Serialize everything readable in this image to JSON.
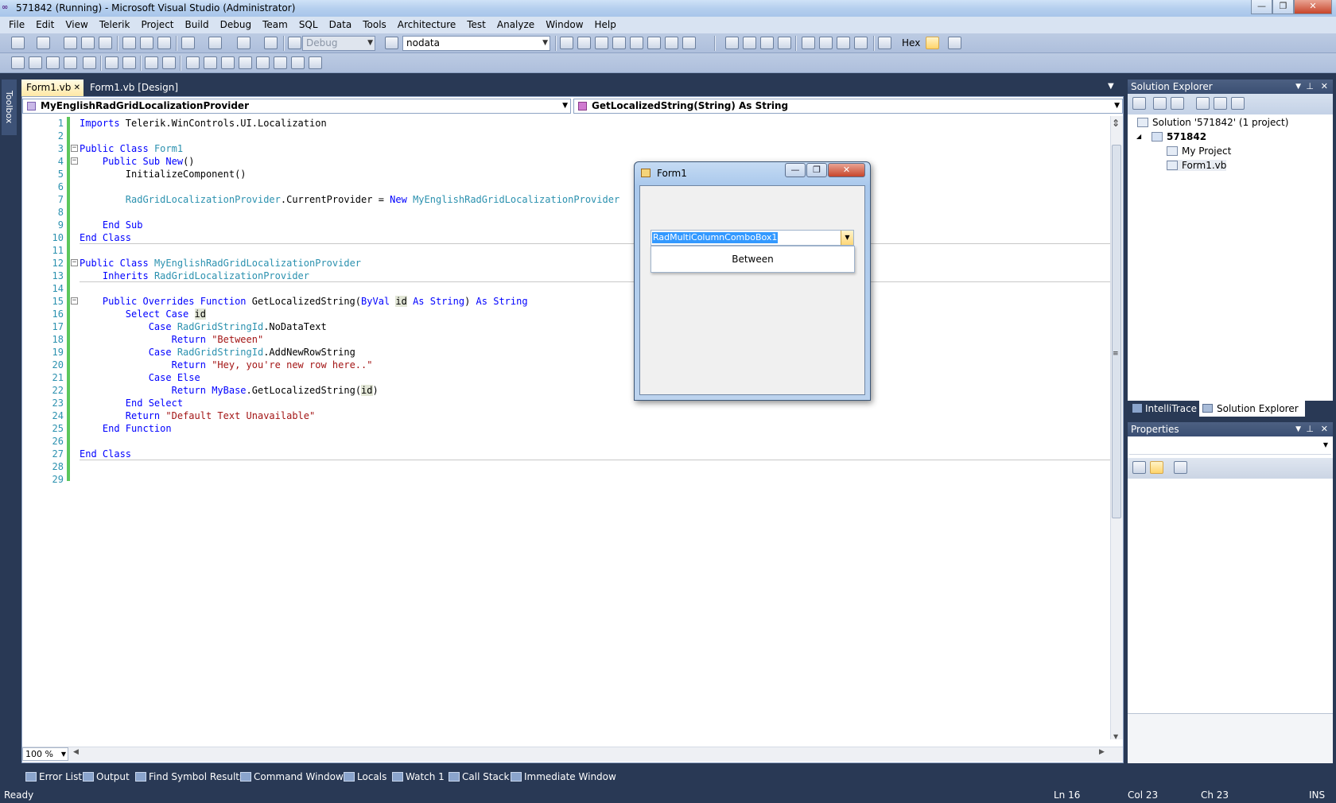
{
  "window": {
    "title": "571842 (Running) - Microsoft Visual Studio (Administrator)",
    "minimize_label": "—",
    "restore_label": "❐",
    "close_label": "✕"
  },
  "menu": [
    "File",
    "Edit",
    "View",
    "Telerik",
    "Project",
    "Build",
    "Debug",
    "Team",
    "SQL",
    "Data",
    "Tools",
    "Architecture",
    "Test",
    "Analyze",
    "Window",
    "Help"
  ],
  "toolbar": {
    "config_value": "Debug",
    "find_value": "nodata",
    "hex_label": "Hex"
  },
  "toolbox_label": "Toolbox",
  "doc_tabs": [
    {
      "label": "Form1.vb",
      "close": "✕",
      "active": true
    },
    {
      "label": "Form1.vb [Design]",
      "active": false
    }
  ],
  "navigation": {
    "class_value": "MyEnglishRadGridLocalizationProvider",
    "member_value": "GetLocalizedString(String) As String"
  },
  "code_lines": [
    {
      "n": "1",
      "segments": [
        {
          "t": "Imports",
          "c": "kw"
        },
        {
          "t": " Telerik.WinControls.UI.Localization",
          "c": ""
        }
      ]
    },
    {
      "n": "2",
      "segments": []
    },
    {
      "n": "3",
      "fold": true,
      "segments": [
        {
          "t": "Public Class",
          "c": "kw"
        },
        {
          "t": " ",
          "c": ""
        },
        {
          "t": "Form1",
          "c": "ty"
        }
      ]
    },
    {
      "n": "4",
      "fold": true,
      "segments": [
        {
          "t": "    Public Sub",
          "c": "kw"
        },
        {
          "t": " ",
          "c": ""
        },
        {
          "t": "New",
          "c": "kw"
        },
        {
          "t": "()",
          "c": ""
        }
      ]
    },
    {
      "n": "5",
      "segments": [
        {
          "t": "        InitializeComponent()",
          "c": ""
        }
      ]
    },
    {
      "n": "6",
      "segments": []
    },
    {
      "n": "7",
      "segments": [
        {
          "t": "        ",
          "c": ""
        },
        {
          "t": "RadGridLocalizationProvider",
          "c": "ty"
        },
        {
          "t": ".CurrentProvider = ",
          "c": ""
        },
        {
          "t": "New",
          "c": "kw"
        },
        {
          "t": " ",
          "c": ""
        },
        {
          "t": "MyEnglishRadGridLocalizationProvider",
          "c": "ty"
        }
      ]
    },
    {
      "n": "8",
      "segments": []
    },
    {
      "n": "9",
      "segments": [
        {
          "t": "    End Sub",
          "c": "kw"
        }
      ]
    },
    {
      "n": "10",
      "segments": [
        {
          "t": "End Class",
          "c": "kw"
        }
      ]
    },
    {
      "n": "11",
      "segments": []
    },
    {
      "n": "12",
      "fold": true,
      "segments": [
        {
          "t": "Public Class",
          "c": "kw"
        },
        {
          "t": " ",
          "c": ""
        },
        {
          "t": "MyEnglishRadGridLocalizationProvider",
          "c": "ty"
        }
      ]
    },
    {
      "n": "13",
      "segments": [
        {
          "t": "    Inherits",
          "c": "kw"
        },
        {
          "t": " ",
          "c": ""
        },
        {
          "t": "RadGridLocalizationProvider",
          "c": "ty"
        }
      ]
    },
    {
      "n": "14",
      "segments": []
    },
    {
      "n": "15",
      "fold": true,
      "segments": [
        {
          "t": "    Public Overrides Function",
          "c": "kw"
        },
        {
          "t": " GetLocalizedString(",
          "c": ""
        },
        {
          "t": "ByVal",
          "c": "kw"
        },
        {
          "t": " ",
          "c": ""
        },
        {
          "t": "id",
          "c": "hl"
        },
        {
          "t": " ",
          "c": ""
        },
        {
          "t": "As String",
          "c": "kw"
        },
        {
          "t": ") ",
          "c": ""
        },
        {
          "t": "As String",
          "c": "kw"
        }
      ]
    },
    {
      "n": "16",
      "segments": [
        {
          "t": "        Select Case",
          "c": "kw"
        },
        {
          "t": " ",
          "c": ""
        },
        {
          "t": "id",
          "c": "hl"
        }
      ]
    },
    {
      "n": "17",
      "segments": [
        {
          "t": "            Case",
          "c": "kw"
        },
        {
          "t": " ",
          "c": ""
        },
        {
          "t": "RadGridStringId",
          "c": "ty"
        },
        {
          "t": ".NoDataText",
          "c": ""
        }
      ]
    },
    {
      "n": "18",
      "segments": [
        {
          "t": "                Return",
          "c": "kw"
        },
        {
          "t": " ",
          "c": ""
        },
        {
          "t": "\"Between\"",
          "c": "st"
        }
      ]
    },
    {
      "n": "19",
      "segments": [
        {
          "t": "            Case",
          "c": "kw"
        },
        {
          "t": " ",
          "c": ""
        },
        {
          "t": "RadGridStringId",
          "c": "ty"
        },
        {
          "t": ".AddNewRowString",
          "c": ""
        }
      ]
    },
    {
      "n": "20",
      "segments": [
        {
          "t": "                Return",
          "c": "kw"
        },
        {
          "t": " ",
          "c": ""
        },
        {
          "t": "\"Hey, you're new row here..\"",
          "c": "st"
        }
      ]
    },
    {
      "n": "21",
      "segments": [
        {
          "t": "            Case Else",
          "c": "kw"
        }
      ]
    },
    {
      "n": "22",
      "segments": [
        {
          "t": "                Return",
          "c": "kw"
        },
        {
          "t": " ",
          "c": ""
        },
        {
          "t": "MyBase",
          "c": "kw"
        },
        {
          "t": ".GetLocalizedString(",
          "c": ""
        },
        {
          "t": "id",
          "c": "hl"
        },
        {
          "t": ")",
          "c": ""
        }
      ]
    },
    {
      "n": "23",
      "segments": [
        {
          "t": "        End Select",
          "c": "kw"
        }
      ]
    },
    {
      "n": "24",
      "segments": [
        {
          "t": "        Return",
          "c": "kw"
        },
        {
          "t": " ",
          "c": ""
        },
        {
          "t": "\"Default Text Unavailable\"",
          "c": "st"
        }
      ]
    },
    {
      "n": "25",
      "segments": [
        {
          "t": "    End Function",
          "c": "kw"
        }
      ]
    },
    {
      "n": "26",
      "segments": []
    },
    {
      "n": "27",
      "segments": [
        {
          "t": "End Class",
          "c": "kw"
        }
      ]
    },
    {
      "n": "28",
      "segments": []
    },
    {
      "n": "29",
      "segments": []
    }
  ],
  "zoom": "100 %",
  "form1": {
    "title": "Form1",
    "combo_text": "RadMultiColumnComboBox1",
    "dropdown_text": "Between"
  },
  "solution_explorer": {
    "title": "Solution Explorer",
    "solution": "Solution '571842' (1 project)",
    "project": "571842",
    "items": [
      "My Project",
      "Form1.vb"
    ]
  },
  "panel_tabs": [
    "IntelliTrace",
    "Solution Explorer"
  ],
  "properties": {
    "title": "Properties"
  },
  "bottom_tabs": [
    "Error List",
    "Output",
    "Find Symbol Results",
    "Command Window",
    "Locals",
    "Watch 1",
    "Call Stack",
    "Immediate Window"
  ],
  "status": {
    "text": "Ready",
    "ln": "Ln 16",
    "col": "Col 23",
    "ch": "Ch 23",
    "mode": "INS"
  }
}
